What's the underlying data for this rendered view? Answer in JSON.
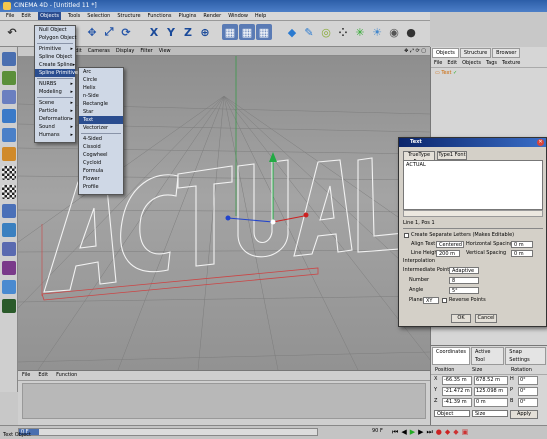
{
  "window": {
    "title": "CINEMA 4D - [Untitled 11 *]"
  },
  "menubar": [
    "File",
    "Edit",
    "Objects",
    "Tools",
    "Selection",
    "Structure",
    "Functions",
    "Plugins",
    "Render",
    "Window",
    "Help"
  ],
  "viewport": {
    "menu": [
      "Edit",
      "Cameras",
      "Display",
      "Filter",
      "View"
    ],
    "text_object": "ACTUAL"
  },
  "objects_menu": [
    {
      "label": "Null Object",
      "arrow": ""
    },
    {
      "label": "Polygon Object",
      "arrow": ""
    },
    {
      "label": "Primitive",
      "arrow": "▸"
    },
    {
      "label": "Spline Object",
      "arrow": ""
    },
    {
      "label": "Create Spline",
      "arrow": "▸"
    },
    {
      "label": "Spline Primitive",
      "arrow": "▸"
    },
    {
      "label": "NURBS",
      "arrow": "▸"
    },
    {
      "label": "Modeling",
      "arrow": "▸"
    },
    {
      "label": "Scene",
      "arrow": "▸"
    },
    {
      "label": "Particle",
      "arrow": "▸"
    },
    {
      "label": "Deformation",
      "arrow": "▸"
    },
    {
      "label": "Sound",
      "arrow": "▸"
    },
    {
      "label": "Humans",
      "arrow": "▸"
    }
  ],
  "spline_menu": [
    "Arc",
    "Circle",
    "Helix",
    "n-Side",
    "Rectangle",
    "Star",
    "Text",
    "Vectorizer",
    "4-Sided",
    "Cissoid",
    "Cogwheel",
    "Cycloid",
    "Formula",
    "Flower",
    "Profile"
  ],
  "right_panel": {
    "tabs": [
      "Objects",
      "Structure",
      "Browser"
    ],
    "menu": [
      "File",
      "Edit",
      "Objects",
      "Tags",
      "Texture"
    ],
    "item": "Text"
  },
  "text_dialog": {
    "title": "Text",
    "font_buttons": [
      "TrueType Font",
      "Type1 Font"
    ],
    "text_value": "ACTUAL",
    "line_info": "Line 1, Pos 1",
    "separate_label": "Create Separate Letters (Makes Editable)",
    "align_label": "Align Text",
    "align_value": "Centered",
    "hspace_label": "Horizontal Spacing",
    "hspace_value": "0 m",
    "lineheight_label": "Line Height",
    "lineheight_value": "200 m",
    "vspace_label": "Vertical Spacing",
    "vspace_value": "0 m",
    "interp_label": "Interpolation",
    "intermediate_label": "Intermediate Points",
    "intermediate_value": "Adaptive",
    "number_label": "Number",
    "number_value": "8",
    "angle_label": "Angle",
    "angle_value": "5°",
    "plane_label": "Plane",
    "plane_value": "XY",
    "reverse_label": "Reverse Points",
    "ok": "OK",
    "cancel": "Cancel"
  },
  "coordinates": {
    "tabs": [
      "Coordinates",
      "Active Tool",
      "Snap Settings"
    ],
    "headers": [
      "Position",
      "Size",
      "Rotation"
    ],
    "rows": [
      {
        "axis": "X",
        "pos": "-66.35 m",
        "size": "678.52 m",
        "rot_axis": "H",
        "rot": "0°"
      },
      {
        "axis": "Y",
        "pos": "-21.472 m",
        "size": "125.098 m",
        "rot_axis": "P",
        "rot": "0°"
      },
      {
        "axis": "Z",
        "pos": "-41.39 m",
        "size": "0 m",
        "rot_axis": "B",
        "rot": "0°"
      }
    ],
    "mode1": "Object",
    "mode2": "Size",
    "apply": "Apply"
  },
  "timeline": {
    "menu": [
      "File",
      "Edit",
      "Function"
    ],
    "frame": "0 F",
    "end_frame": "90 F"
  },
  "status": {
    "text": "Text Object"
  },
  "colors": {
    "title": "#2c5ea8",
    "menu_highlight": "#2a4d8f",
    "viewport": "#9a9a9a",
    "text_spline": "#f2f2f2",
    "axis_red": "#cc2222",
    "axis_green": "#22aa44"
  }
}
